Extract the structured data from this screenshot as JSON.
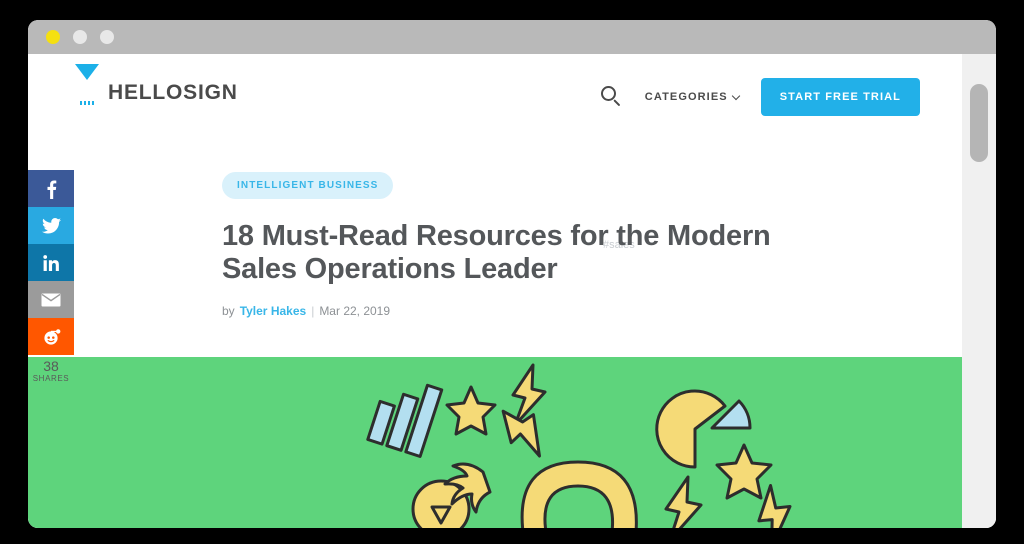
{
  "window": {
    "traffic_lights": [
      {
        "name": "close",
        "color": "#f5e010"
      },
      {
        "name": "minimize",
        "color": "#e8e8e8"
      },
      {
        "name": "maximize",
        "color": "#e8e8e8"
      }
    ],
    "titlebar_color": "#b9b9b9"
  },
  "header": {
    "logo_text": "HELLOSIGN",
    "logo_color": "#1cb0e8",
    "search_icon": "search-icon",
    "categories_label": "CATEGORIES",
    "categories_chevron": "chevron-down-icon",
    "cta_label": "START FREE TRIAL",
    "cta_color": "#22b0e8"
  },
  "share": {
    "buttons": [
      {
        "name": "facebook",
        "label": "Facebook",
        "color": "#3b5998"
      },
      {
        "name": "twitter",
        "label": "Twitter",
        "color": "#29a9e1"
      },
      {
        "name": "linkedin",
        "label": "LinkedIn",
        "color": "#0e76a8"
      },
      {
        "name": "email",
        "label": "Email",
        "color": "#9b9b9b"
      },
      {
        "name": "reddit",
        "label": "Reddit",
        "color": "#ff5700"
      }
    ],
    "count": "38",
    "count_label": "SHARES"
  },
  "article": {
    "category": "INTELLIGENT BUSINESS",
    "category_bg": "#d9f1fb",
    "category_fg": "#38b6e8",
    "title": "18 Must-Read Resources for the Modern Sales Operations Leader",
    "by_prefix": "by",
    "author": "Tyler Hakes",
    "separator": "|",
    "date": "Mar 22, 2019",
    "tag": "#sales"
  },
  "hero": {
    "background_color": "#5ed47c",
    "accent_yellow": "#f5da77",
    "accent_blue": "#b3dff0",
    "outline": "#2d2d2d",
    "elements": [
      "bar-chart-icon",
      "star-icon",
      "lightning-bolt-icon",
      "pie-chart-icon",
      "lightbulb-icon",
      "magnet-icon"
    ]
  },
  "scrollbar": {
    "track_color": "#f0f0f0",
    "thumb_color": "#b5b5b5"
  }
}
